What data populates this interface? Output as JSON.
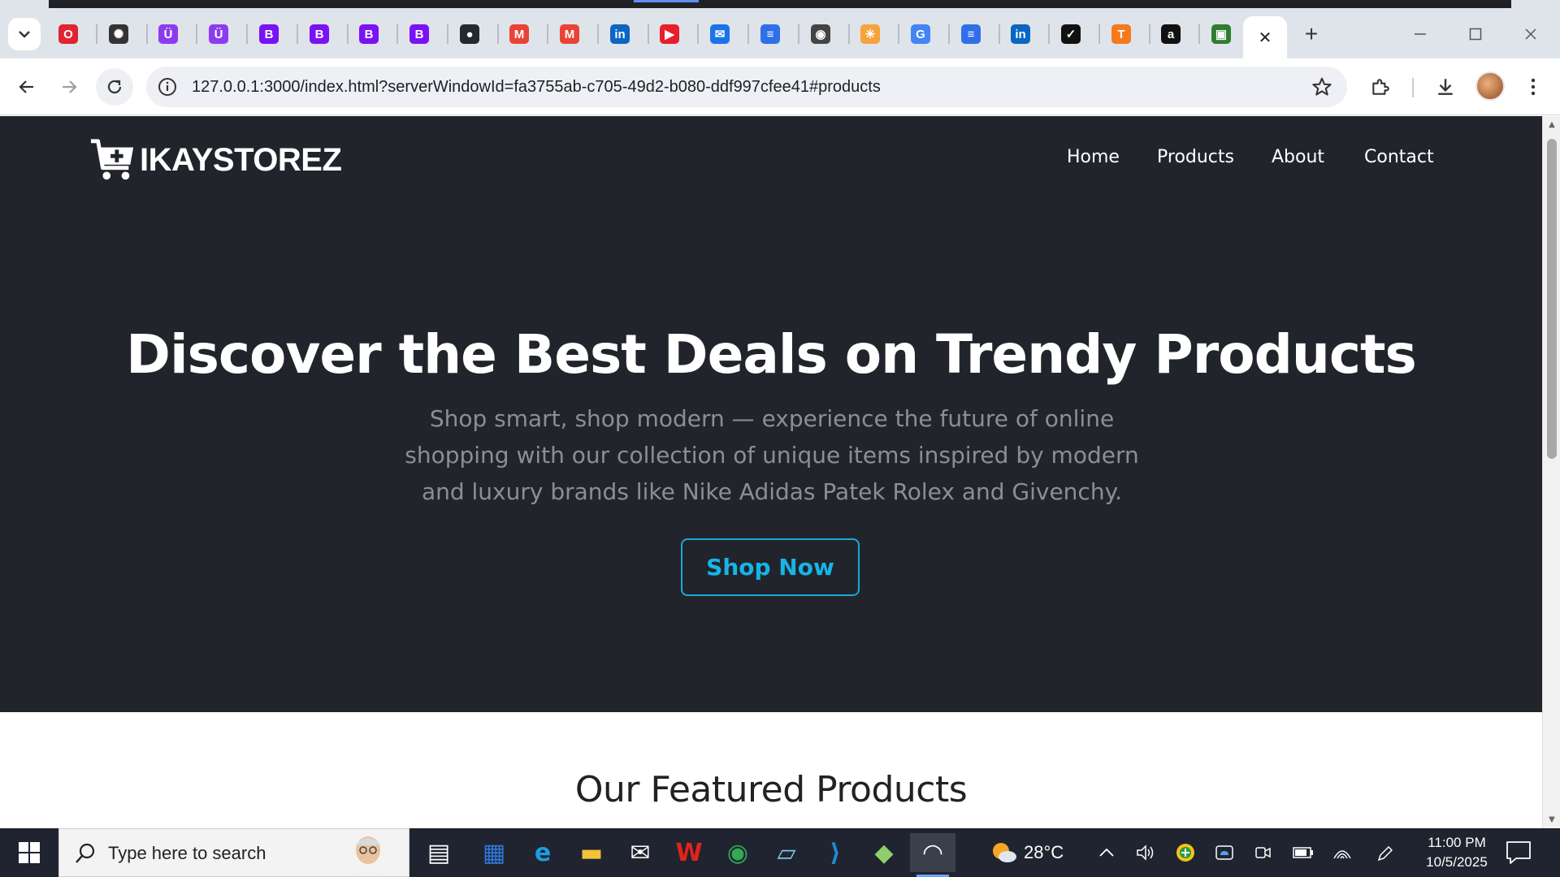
{
  "browser": {
    "url": "127.0.0.1:3000/index.html?serverWindowId=fa3755ab-c705-49d2-b080-ddf997cfee41#products",
    "tabs": [
      {
        "icon": "opera-icon",
        "color": "#e02433",
        "glyph": "O"
      },
      {
        "icon": "chatgpt-icon",
        "color": "#333333",
        "glyph": "✺"
      },
      {
        "icon": "udemy-icon",
        "color": "#8c3cf0",
        "glyph": "Ü"
      },
      {
        "icon": "udemy-icon",
        "color": "#8c3cf0",
        "glyph": "Ü"
      },
      {
        "icon": "bootstrap-icon",
        "color": "#7a12f5",
        "glyph": "B"
      },
      {
        "icon": "bootstrap-icon",
        "color": "#7a12f5",
        "glyph": "B"
      },
      {
        "icon": "bootstrap-icon",
        "color": "#7a12f5",
        "glyph": "B"
      },
      {
        "icon": "bootstrap-icon",
        "color": "#7a12f5",
        "glyph": "B"
      },
      {
        "icon": "github-icon",
        "color": "#24292f",
        "glyph": "●"
      },
      {
        "icon": "gmail-icon",
        "color": "#ea4335",
        "glyph": "M"
      },
      {
        "icon": "gmail-icon",
        "color": "#ea4335",
        "glyph": "M"
      },
      {
        "icon": "linkedin-icon",
        "color": "#0a66c2",
        "glyph": "in"
      },
      {
        "icon": "youtube-music-icon",
        "color": "#e81e2c",
        "glyph": "▶"
      },
      {
        "icon": "mail-open-icon",
        "color": "#1b73e8",
        "glyph": "✉"
      },
      {
        "icon": "google-docs-icon",
        "color": "#2f6fe8",
        "glyph": "≡"
      },
      {
        "icon": "globe-icon",
        "color": "#444444",
        "glyph": "◉"
      },
      {
        "icon": "snowflake-icon",
        "color": "#f4a43b",
        "glyph": "✳"
      },
      {
        "icon": "google-icon",
        "color": "#4285f4",
        "glyph": "G"
      },
      {
        "icon": "google-docs-icon",
        "color": "#2f6fe8",
        "glyph": "≡"
      },
      {
        "icon": "linkedin-icon",
        "color": "#0a66c2",
        "glyph": "in"
      },
      {
        "icon": "nike-icon",
        "color": "#111111",
        "glyph": "✓"
      },
      {
        "icon": "temu-icon",
        "color": "#f57a1c",
        "glyph": "T"
      },
      {
        "icon": "amazon-icon",
        "color": "#111111",
        "glyph": "a"
      },
      {
        "icon": "gift-bag-icon",
        "color": "#2e7d32",
        "glyph": "▣"
      }
    ],
    "new_tab": "+",
    "close_tab": "✕"
  },
  "site": {
    "brand": "IKAYSTOREZ",
    "nav": [
      "Home",
      "Products",
      "About",
      "Contact"
    ],
    "hero_title": "Discover the Best Deals on Trendy Products",
    "hero_subtitle_lines": [
      "Shop smart, shop modern — experience the future of online",
      "shopping with our collection of unique items inspired by modern",
      "and luxury brands like Nike Adidas Patek Rolex and Givenchy."
    ],
    "cta": "Shop Now",
    "section_title": "Our Featured Products",
    "colors": {
      "hero_bg": "#21252b",
      "accent": "#17b4e8",
      "subtitle": "#8a8f96"
    }
  },
  "taskbar": {
    "search_placeholder": "Type here to search",
    "weather": "28°C",
    "time": "11:00 PM",
    "date": "10/5/2025",
    "apps": [
      "task-view-icon",
      "microsoft-store-icon",
      "edge-icon",
      "file-explorer-icon",
      "mail-icon",
      "wps-office-icon",
      "chrome-icon",
      "notepad-icon",
      "vscode-icon",
      "game-icon",
      "remote-app-icon"
    ]
  }
}
